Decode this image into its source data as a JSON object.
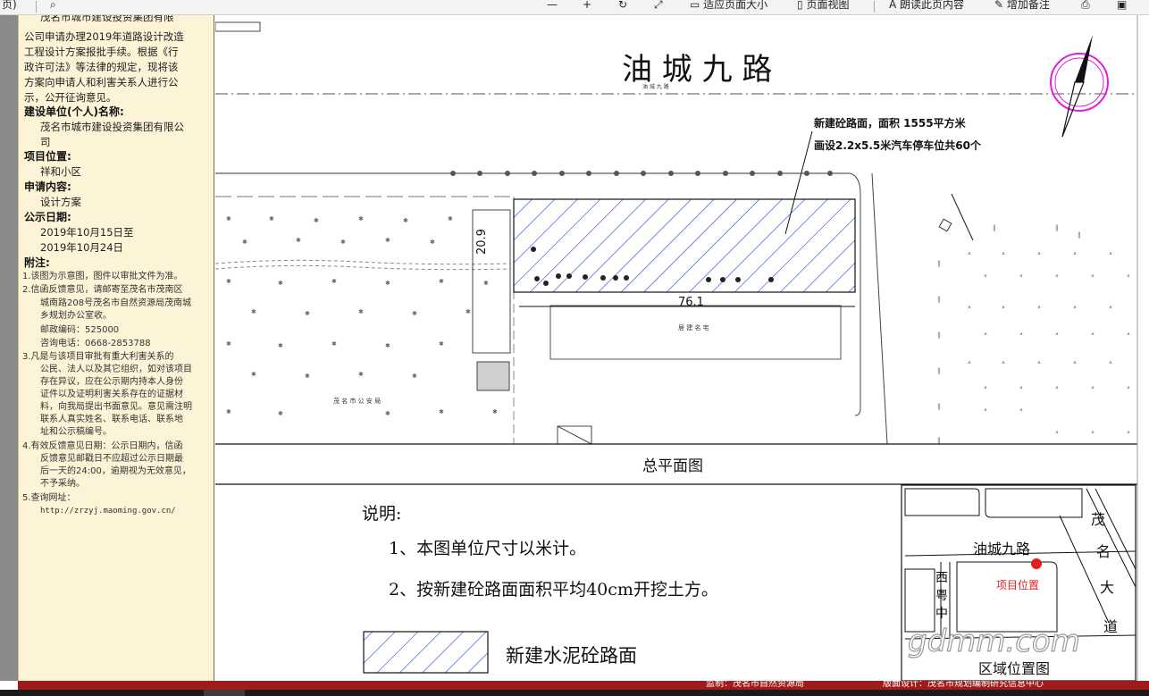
{
  "toolbar": {
    "page_label": "页)",
    "fit_page": "适应页面大小",
    "page_view": "页面视图",
    "read_aloud": "朗读此页内容",
    "add_note": "增加备注"
  },
  "sidebar": {
    "intro": [
      "茂名市城市建设投资集团有限",
      "公司申请办理2019年道路设计改造",
      "工程设计方案报批手续。根据《行",
      "政许可法》等法律的规定，现将该",
      "方案向申请人和利害关系人进行公",
      "示，公开征询意见。"
    ],
    "builder_label": "建设单位(个人)名称:",
    "builder_value": [
      "茂名市城市建设投资集团有限公",
      "司"
    ],
    "location_label": "项目位置:",
    "location_value": "祥和小区",
    "content_label": "申请内容:",
    "content_value": "设计方案",
    "date_label": "公示日期:",
    "date_from": "2019年10月15日至",
    "date_to": "2019年10月24日",
    "notes_label": "附注:",
    "note1": "1.该图为示意图，图件以审批文件为准。",
    "note2": [
      "2.信函反馈意见，请邮寄至茂名市茂南区",
      "城南路208号茂名市自然资源局茂南城",
      "乡规划办公室收。"
    ],
    "postcode": "邮政编码：525000",
    "phone": "咨询电话：0668-2853788",
    "note3": [
      "3.凡是与该项目审批有重大利害关系的",
      "公民、法人以及其它组织，如对该项目",
      "存在异议，应在公示期内持本人身份",
      "证件以及证明利害关系存在的证据材",
      "料，向我局提出书面意见。意见需注明",
      "联系人真实姓名、联系电话、联系地",
      "址和公示稿编号。"
    ],
    "note4": [
      "4.有效反馈意见日期：公示日期内，信函",
      "反馈意见邮戳日不应超过公示日期最",
      "后一天的24:00，逾期视为无效意见，",
      "不予采纳。"
    ],
    "note5": "5.查询网址：",
    "url": "http://zrzyj.maoming.gov.cn/"
  },
  "drawing": {
    "road_title": "油 城 九 路",
    "road_small": "油 城 九 路",
    "annot_line1": "新建砼路面，面积 1555平方米",
    "annot_line2": "画设2.2x5.5米汽车停车位共60个",
    "dim_vertical": "20.9",
    "dim_horizontal": "76.1",
    "bldg_label": "居 建 名 宅",
    "police_label": "茂 名 市 公 安 局",
    "plan_title": "总平面图",
    "notes_heading": "说明:",
    "note_line1": "1、本图单位尺寸以米计。",
    "note_line2": "2、按新建砼路面面积平均40cm开挖土方。",
    "legend_label": "新建水泥砼路面",
    "map_road": "油城九路",
    "map_project": "项目位置",
    "map_road2": [
      "茂",
      "名",
      "大",
      "道"
    ],
    "map_road3": [
      "西",
      "粤",
      "中"
    ],
    "map_caption": "区域位置图",
    "watermark": "gdmm.com"
  },
  "footer": {
    "left_text": "监制：茂名市自然资源局",
    "right_text": "版面设计：茂名市规划编制研究信息中心"
  },
  "colors": {
    "sidebar_bg": "#fdf3d6",
    "hatch": "#1c3fd0",
    "compass": "#e020e0",
    "marker": "#e02020",
    "footer_bg": "#a01c1c"
  }
}
